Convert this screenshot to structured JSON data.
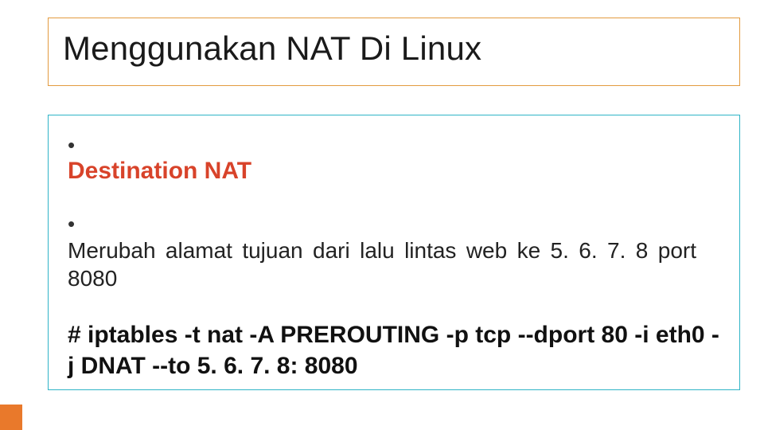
{
  "slide": {
    "title": "Menggunakan NAT Di Linux",
    "bullets": [
      {
        "text": "Destination NAT",
        "style": "dest"
      },
      {
        "text": "Merubah alamat tujuan dari lalu lintas web ke 5. 6. 7. 8 port 8080",
        "style": "desc"
      }
    ],
    "command": "# iptables -t nat -A PREROUTING -p tcp --dport 80 -i eth0 -j DNAT --to 5. 6. 7. 8: 8080"
  }
}
